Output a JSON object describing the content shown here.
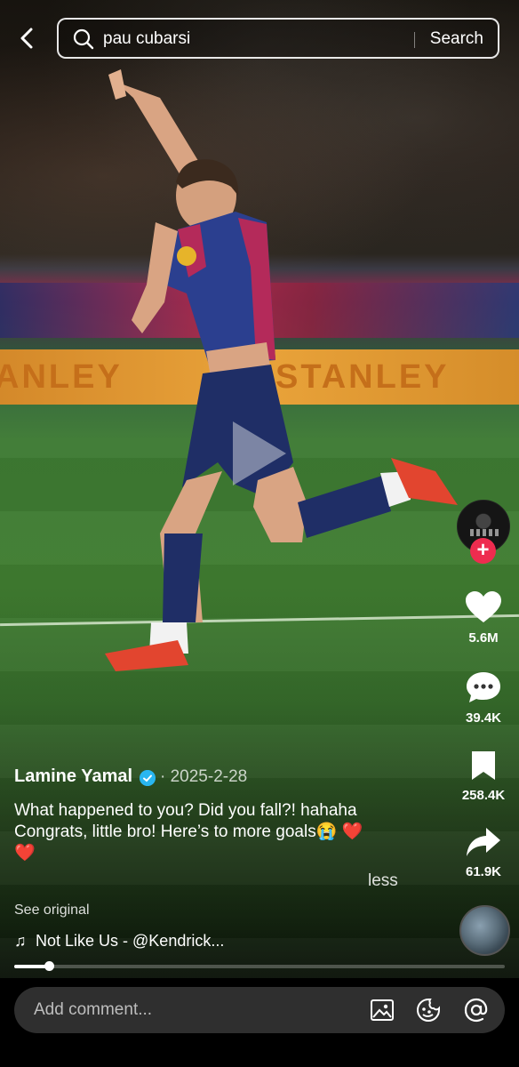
{
  "search": {
    "query": "pau cubarsi",
    "button_label": "Search"
  },
  "board_text": {
    "left": "ANLEY",
    "right": "STANLEY"
  },
  "rail": {
    "likes": "5.6M",
    "comments": "39.4K",
    "saves": "258.4K",
    "shares": "61.9K"
  },
  "post": {
    "author": "Lamine Yamal",
    "date": "· 2025-2-28",
    "caption_line1": "What happened to you? Did you fall?! hahaha",
    "caption_line2": "Congrats, little bro! Here’s to more goals😭 ❤️",
    "caption_line3": "❤️",
    "less_label": "less",
    "see_original": "See original",
    "music": "Not Like Us - @Kendrick..."
  },
  "progress": {
    "fraction": 0.07
  },
  "comment_bar": {
    "placeholder": "Add comment..."
  },
  "colors": {
    "follow": "#ee2c4f",
    "verified": "#29b6f0"
  }
}
